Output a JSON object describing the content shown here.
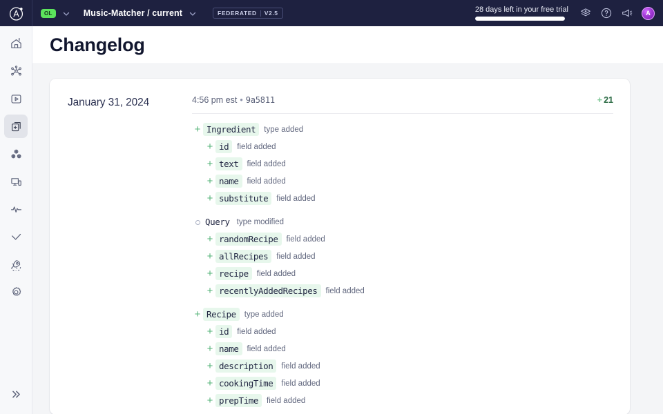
{
  "topbar": {
    "logo_name": "apollo-logo",
    "graph_badge": "OL",
    "project_title": "Music-Matcher / current",
    "federated_label": "FEDERATED",
    "version_label": "V2.5",
    "trial_text": "28 days left in your free trial",
    "trial_progress": 100,
    "icons": [
      "layers-icon",
      "help-icon",
      "megaphone-icon"
    ],
    "avatar_initial": "A"
  },
  "sidebar": {
    "items": [
      {
        "name": "home",
        "icon": "home-icon",
        "active": false
      },
      {
        "name": "schema",
        "icon": "graph-nodes-icon",
        "active": false
      },
      {
        "name": "explorer",
        "icon": "play-square-icon",
        "active": false
      },
      {
        "name": "changelog",
        "icon": "changelog-pages-icon",
        "active": true
      },
      {
        "name": "subgraphs",
        "icon": "cubes-icon",
        "active": false
      },
      {
        "name": "clients",
        "icon": "devices-icon",
        "active": false
      },
      {
        "name": "insights",
        "icon": "pulse-icon",
        "active": false
      },
      {
        "name": "checks",
        "icon": "check-icon",
        "active": false
      },
      {
        "name": "launches",
        "icon": "rocket-icon",
        "active": false
      },
      {
        "name": "settings",
        "icon": "gear-icon",
        "active": false
      }
    ],
    "collapse_icon": "double-chevron-right-icon"
  },
  "page": {
    "title": "Changelog"
  },
  "entry": {
    "date": "January 31, 2024",
    "time": "4:56 pm est",
    "separator": "•",
    "hash": "9a5811",
    "count_plus": "+",
    "count_value": "21",
    "changes": [
      {
        "level": 1,
        "marker": "added",
        "name": "Ingredient",
        "kind": "type added",
        "highlight": true,
        "group_start": false
      },
      {
        "level": 2,
        "marker": "added",
        "name": "id",
        "kind": "field added",
        "highlight": true,
        "group_start": false
      },
      {
        "level": 2,
        "marker": "added",
        "name": "text",
        "kind": "field added",
        "highlight": true,
        "group_start": false
      },
      {
        "level": 2,
        "marker": "added",
        "name": "name",
        "kind": "field added",
        "highlight": true,
        "group_start": false
      },
      {
        "level": 2,
        "marker": "added",
        "name": "substitute",
        "kind": "field added",
        "highlight": true,
        "group_start": false
      },
      {
        "level": 1,
        "marker": "modified",
        "name": "Query",
        "kind": "type modified",
        "highlight": false,
        "group_start": true
      },
      {
        "level": 2,
        "marker": "added",
        "name": "randomRecipe",
        "kind": "field added",
        "highlight": true,
        "group_start": false
      },
      {
        "level": 2,
        "marker": "added",
        "name": "allRecipes",
        "kind": "field added",
        "highlight": true,
        "group_start": false
      },
      {
        "level": 2,
        "marker": "added",
        "name": "recipe",
        "kind": "field added",
        "highlight": true,
        "group_start": false
      },
      {
        "level": 2,
        "marker": "added",
        "name": "recentlyAddedRecipes",
        "kind": "field added",
        "highlight": true,
        "group_start": false
      },
      {
        "level": 1,
        "marker": "added",
        "name": "Recipe",
        "kind": "type added",
        "highlight": true,
        "group_start": true
      },
      {
        "level": 2,
        "marker": "added",
        "name": "id",
        "kind": "field added",
        "highlight": true,
        "group_start": false
      },
      {
        "level": 2,
        "marker": "added",
        "name": "name",
        "kind": "field added",
        "highlight": true,
        "group_start": false
      },
      {
        "level": 2,
        "marker": "added",
        "name": "description",
        "kind": "field added",
        "highlight": true,
        "group_start": false
      },
      {
        "level": 2,
        "marker": "added",
        "name": "cookingTime",
        "kind": "field added",
        "highlight": true,
        "group_start": false
      },
      {
        "level": 2,
        "marker": "added",
        "name": "prepTime",
        "kind": "field added",
        "highlight": true,
        "group_start": false
      }
    ]
  },
  "colors": {
    "topbar_bg": "#1e2140",
    "accent_green": "#5ce45c",
    "added_green": "#53b377",
    "pill_green": "#e7f7ec",
    "count_green": "#2c6b45",
    "page_bg": "#f4f5f7"
  }
}
